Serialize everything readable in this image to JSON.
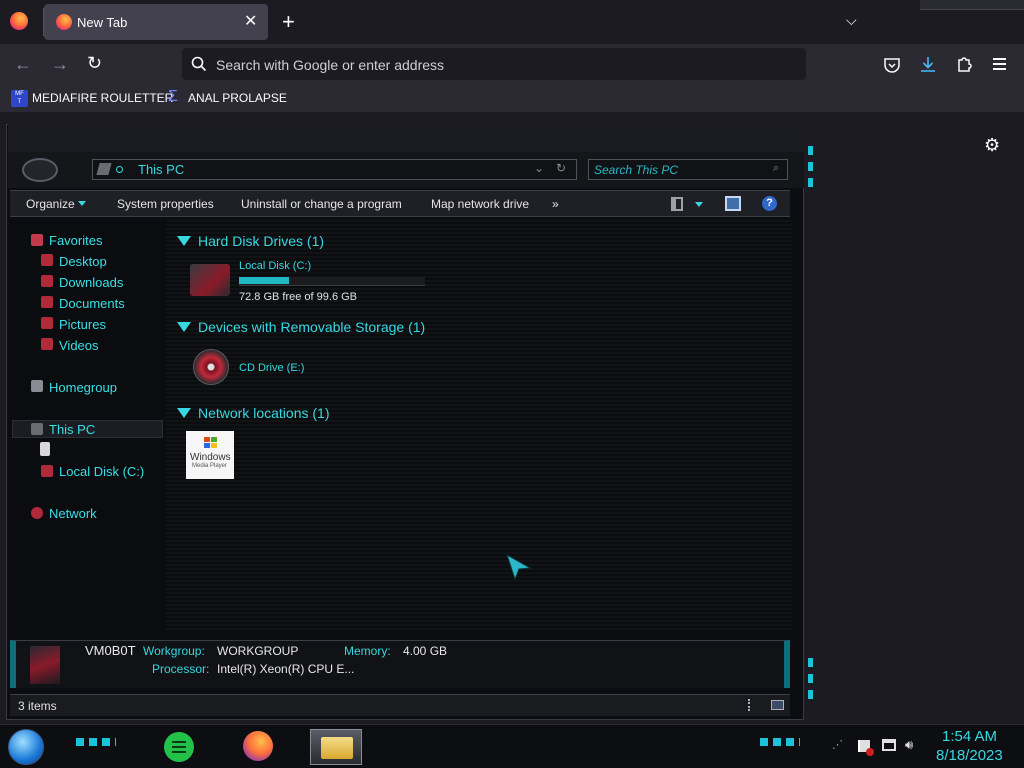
{
  "browser": {
    "tab_title": "New Tab",
    "new_tab_symbol": "+",
    "url_placeholder": "Search with Google or enter address",
    "bookmarks": [
      "MEDIAFIRE ROULETTER",
      "ANAL PROLAPSE"
    ],
    "bookmark_icon_text": "MF\nT"
  },
  "explorer": {
    "address": "This PC",
    "search_placeholder": "Search This PC",
    "commands": [
      "Organize",
      "System properties",
      "Uninstall or change a program",
      "Map network drive",
      "»"
    ],
    "nav": {
      "favorites": "Favorites",
      "favorite_items": [
        "Desktop",
        "Downloads",
        "Documents",
        "Pictures",
        "Videos"
      ],
      "homegroup": "Homegroup",
      "this_pc": "This PC",
      "local_disk": "Local Disk (C:)",
      "network": "Network"
    },
    "groups": [
      {
        "title": "Hard Disk Drives (1)"
      },
      {
        "title": "Devices with Removable Storage (1)"
      },
      {
        "title": "Network locations (1)"
      }
    ],
    "drive": {
      "name": "Local Disk (C:)",
      "free_text": "72.8 GB free of 99.6 GB",
      "used_fraction": 0.269
    },
    "cd": {
      "name": "CD Drive (E:)"
    },
    "network_item_text": [
      "Windows",
      "Media Player"
    ],
    "details": {
      "computer_name": "VM0B0T",
      "workgroup_label": "Workgroup:",
      "workgroup_value": "WORKGROUP",
      "memory_label": "Memory:",
      "memory_value": "4.00 GB",
      "processor_label": "Processor:",
      "processor_value": "Intel(R) Xeon(R) CPU E..."
    },
    "status": "3 items"
  },
  "taskbar": {
    "time": "1:54 AM",
    "date": "8/18/2023"
  },
  "colors": {
    "accent": "#38d8e0",
    "nav_icon": "#b02a3a"
  }
}
